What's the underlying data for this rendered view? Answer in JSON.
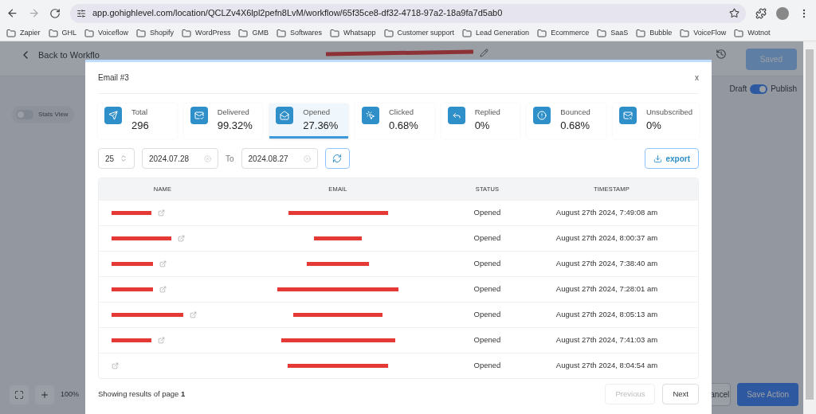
{
  "browser": {
    "url": "app.gohighlevel.com/location/QCLZv4X6lpl2pefn8LvM/workflow/65f35ce8-df32-4718-97a2-18a9fa7d5ab0",
    "bookmarks": [
      "Zapier",
      "GHL",
      "Voiceflow",
      "Shopify",
      "WordPress",
      "GMB",
      "Softwares",
      "Whatsapp",
      "Customer support",
      "Lead Generation",
      "Ecommerce",
      "SaaS",
      "Bubble",
      "VoiceFlow",
      "Wotnot"
    ]
  },
  "app": {
    "back_link": "Back to Workflo",
    "saved_button": "Saved",
    "draft_label": "Draft",
    "publish_label": "Publish",
    "publish_on": true,
    "stats_view_label": "Stats View",
    "stats_view_on": false,
    "zoom": "100%",
    "cancel_button": "ancel",
    "save_action_button": "Save Action"
  },
  "modal": {
    "title": "Email #3",
    "close": "x",
    "stats": [
      {
        "kind": "total",
        "label": "Total",
        "value": "296",
        "selected": false
      },
      {
        "kind": "delivered",
        "label": "Delivered",
        "value": "99.32%",
        "selected": false
      },
      {
        "kind": "opened",
        "label": "Opened",
        "value": "27.36%",
        "selected": true
      },
      {
        "kind": "clicked",
        "label": "Clicked",
        "value": "0.68%",
        "selected": false
      },
      {
        "kind": "replied",
        "label": "Replied",
        "value": "0%",
        "selected": false
      },
      {
        "kind": "bounced",
        "label": "Bounced",
        "value": "0.68%",
        "selected": false
      },
      {
        "kind": "unsubscribed",
        "label": "Unsubscribed",
        "value": "0%",
        "selected": false
      }
    ],
    "page_size": "25",
    "from_date": "2024.07.28",
    "to_label": "To",
    "to_date": "2024.08.27",
    "export_button": "export",
    "table": {
      "columns": [
        "NAME",
        "EMAIL",
        "STATUS",
        "TIMESTAMP"
      ],
      "rows": [
        {
          "status": "Opened",
          "timestamp": "August 27th 2024, 7:49:08 am"
        },
        {
          "status": "Opened",
          "timestamp": "August 27th 2024, 8:00:37 am"
        },
        {
          "status": "Opened",
          "timestamp": "August 27th 2024, 7:38:40 am"
        },
        {
          "status": "Opened",
          "timestamp": "August 27th 2024, 7:28:01 am"
        },
        {
          "status": "Opened",
          "timestamp": "August 27th 2024, 8:05:13 am"
        },
        {
          "status": "Opened",
          "timestamp": "August 27th 2024, 7:41:03 am"
        },
        {
          "status": "Opened",
          "timestamp": "August 27th 2024, 8:04:54 am"
        }
      ]
    },
    "footer": {
      "text": "Showing results of page **1**",
      "previous": "Previous",
      "previous_disabled": true,
      "next": "Next"
    }
  }
}
